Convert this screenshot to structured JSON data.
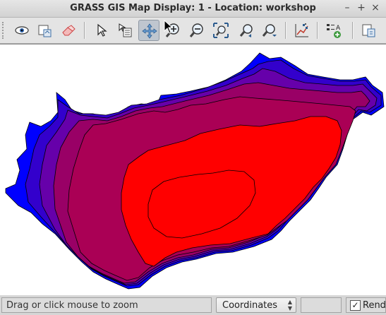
{
  "window": {
    "title": "GRASS GIS Map Display: 1  - Location: workshop"
  },
  "window_controls": {
    "minimize": "–",
    "maximize": "+",
    "close": "×"
  },
  "toolbar": {
    "items": [
      {
        "name": "display-map",
        "icon": "eye-icon"
      },
      {
        "name": "render-map",
        "icon": "render-icon"
      },
      {
        "name": "erase-display",
        "icon": "eraser-icon"
      },
      {
        "name": "pointer",
        "icon": "pointer-arrow-icon"
      },
      {
        "name": "query",
        "icon": "query-icon"
      },
      {
        "name": "pan",
        "icon": "pan-icon",
        "active": true
      },
      {
        "name": "zoom-in",
        "icon": "zoom-in-icon"
      },
      {
        "name": "zoom-out",
        "icon": "zoom-out-icon"
      },
      {
        "name": "zoom-extent",
        "icon": "zoom-extent-icon"
      },
      {
        "name": "zoom-back",
        "icon": "zoom-back-icon"
      },
      {
        "name": "zoom-menu",
        "icon": "zoom-menu-icon"
      },
      {
        "name": "analyze",
        "icon": "analyze-chart-icon"
      },
      {
        "name": "add-decoration",
        "icon": "legend-icon"
      },
      {
        "name": "save-image",
        "icon": "save-display-icon"
      }
    ]
  },
  "map": {
    "description_colors": {
      "band_blue": "#0000ff",
      "band_indigo": "#3300cc",
      "band_violet": "#6600aa",
      "band_purple": "#990066",
      "band_magenta": "#aa0055",
      "band_red": "#ff0000",
      "outline": "#000000"
    }
  },
  "statusbar": {
    "message": "Drag or click mouse to zoom",
    "combo_value": "Coordinates",
    "render_label": "Render",
    "render_checked": "✓"
  }
}
